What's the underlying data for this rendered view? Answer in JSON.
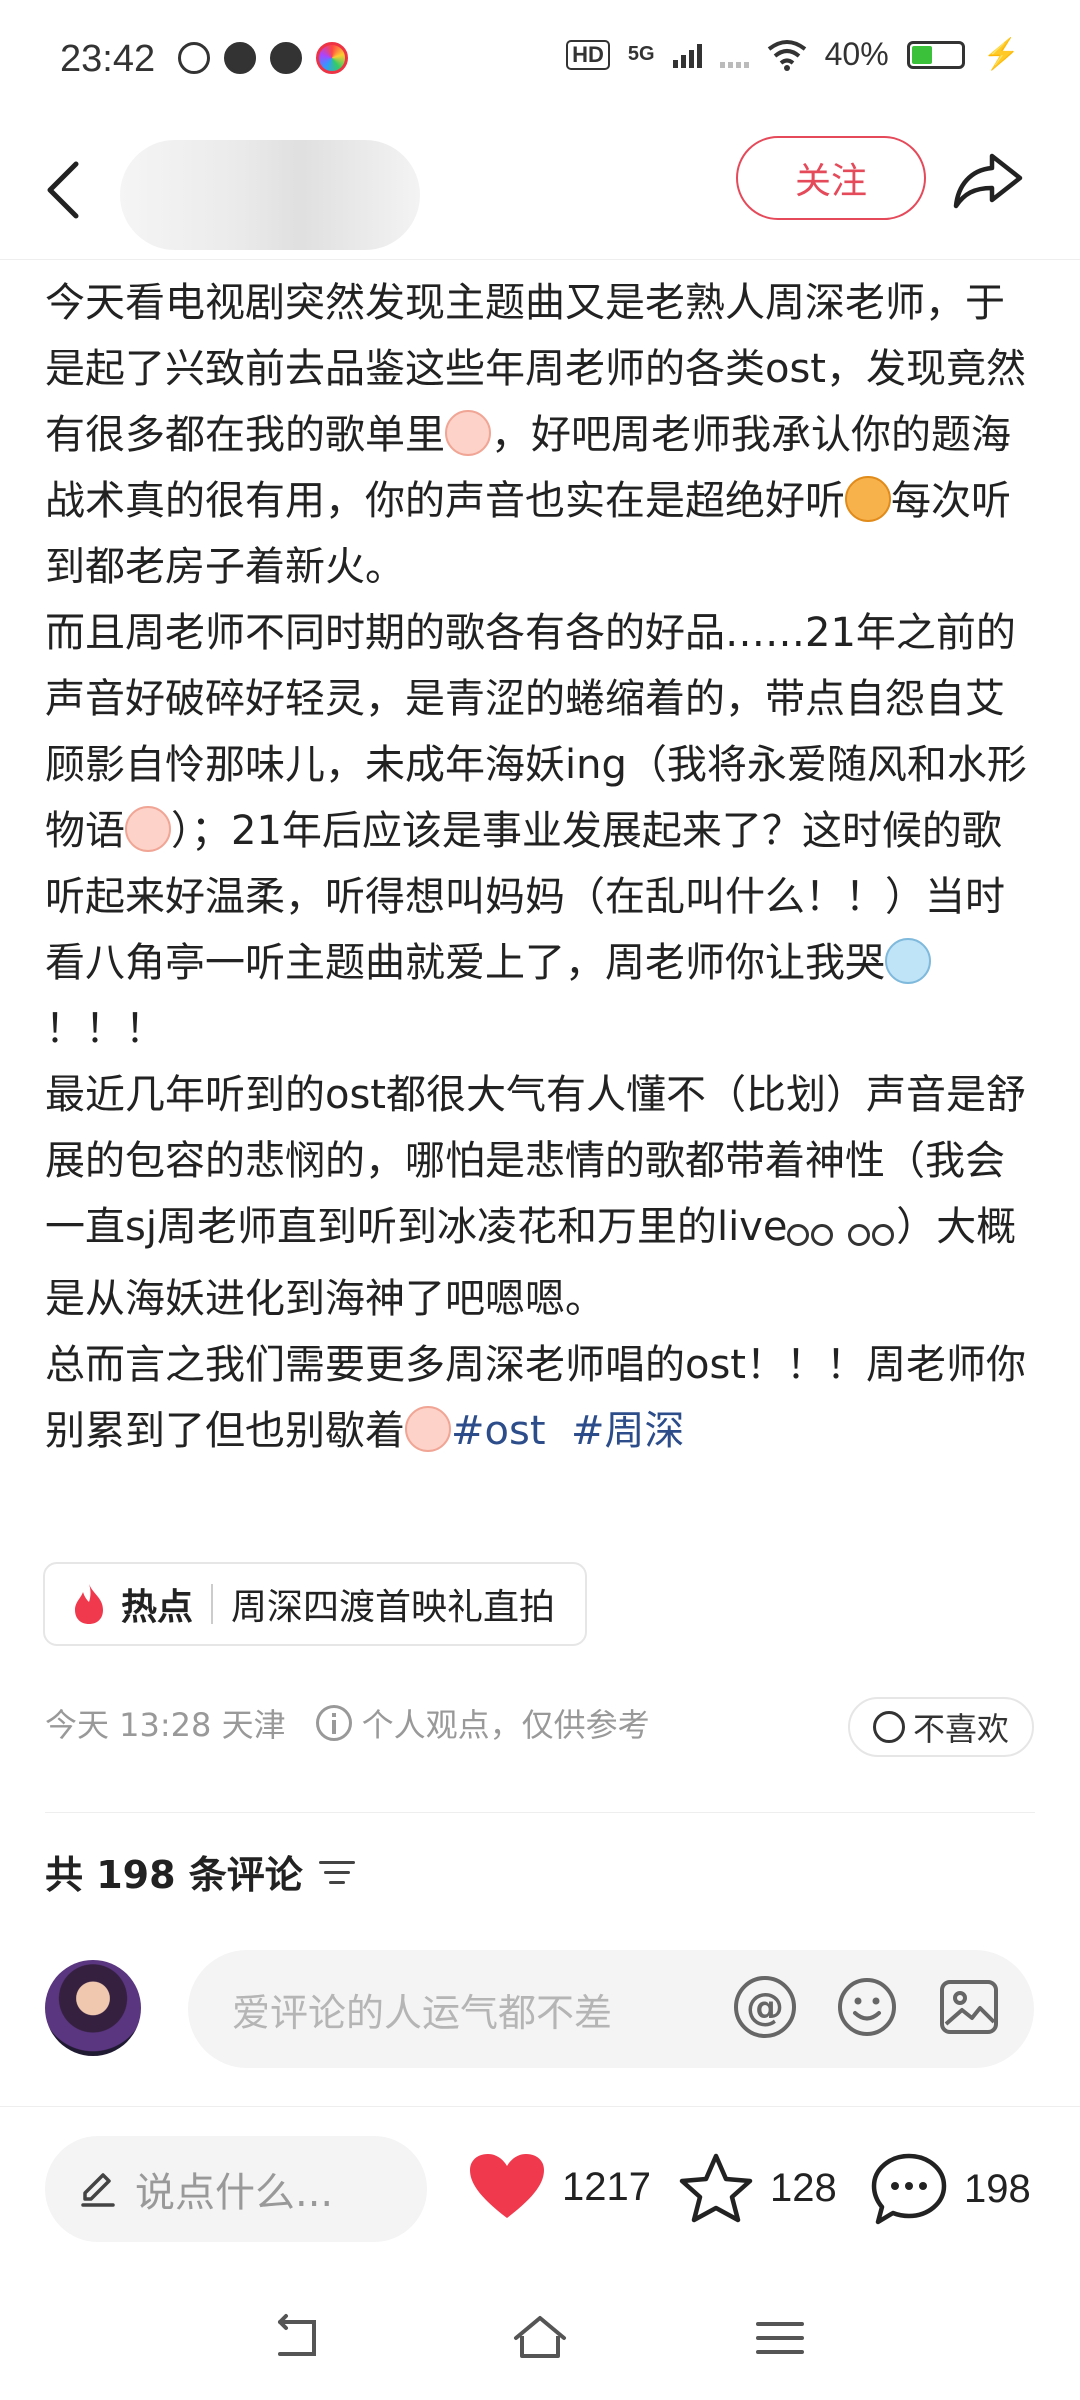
{
  "status_bar": {
    "time": "23:42",
    "network": "5G",
    "hd_label": "HD",
    "battery": "40%",
    "battery_level": 0.4
  },
  "header": {
    "follow_label": "关注",
    "back_icon": "chevron-left-icon",
    "share_icon": "share-arrow-icon"
  },
  "post": {
    "paragraphs": [
      "今天看电视剧突然发现主题曲又是老熟人周深老师，于是起了兴致前去品鉴这些年周老师的各类ost，发现竟然有很多都在我的歌单里",
      "，好吧周老师我承认你的题海战术真的很有用，你的声音也实在是超绝好听",
      "每次听到都老房子着新火。",
      "而且周老师不同时期的歌各有各的好品……21年之前的声音好破碎好轻灵，是青涩的蜷缩着的，带点自怨自艾顾影自怜那味儿，未成年海妖ing（我将永爱随风和水形物语",
      "）；21年后应该是事业发展起来了？这时候的歌听起来好温柔，听得想叫妈妈（在乱叫什么！！）当时看八角亭一听主题曲就爱上了，周老师你让我哭",
      "！！！",
      "最近几年听到的ost都很大气有人懂不（比划）声音是舒展的包容的悲悯的，哪怕是悲情的歌都带着神性（我会一直sj周老师直到听到冰凌花和万里的live",
      "）大概是从海妖进化到海神了吧嗯嗯。",
      "总而言之我们需要更多周深老师唱的ost！！！周老师你别累到了但也别歇着"
    ],
    "hashtags": [
      "#ost",
      "#周深"
    ]
  },
  "hot_tag": {
    "label": "热点",
    "text": "周深四渡首映礼直拍"
  },
  "meta": {
    "time_location": "今天 13:28 天津",
    "disclaimer": "个人观点，仅供参考",
    "dislike_label": "不喜欢"
  },
  "comments": {
    "title": "共 198 条评论",
    "input_placeholder": "爱评论的人运气都不差"
  },
  "actions": {
    "say_placeholder": "说点什么...",
    "likes": "1217",
    "stars": "128",
    "comments": "198",
    "like_color": "#f0394d"
  }
}
